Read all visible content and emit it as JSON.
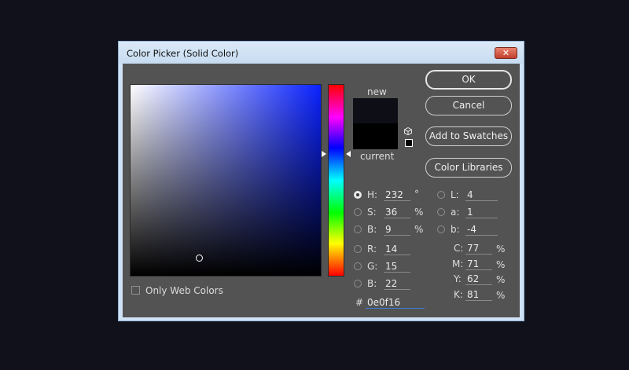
{
  "dialog": {
    "title": "Color Picker (Solid Color)",
    "close_glyph": "✕"
  },
  "preview": {
    "new_label": "new",
    "current_label": "current",
    "new_color": "#0e0f16",
    "current_color": "#000000"
  },
  "buttons": {
    "ok": "OK",
    "cancel": "Cancel",
    "add_to_swatches": "Add to Swatches",
    "color_libraries": "Color Libraries"
  },
  "only_web_colors": "Only Web Colors",
  "hsb": {
    "h": {
      "label": "H:",
      "value": "232",
      "unit": "°"
    },
    "s": {
      "label": "S:",
      "value": "36",
      "unit": "%"
    },
    "b": {
      "label": "B:",
      "value": "9",
      "unit": "%"
    }
  },
  "rgb": {
    "r": {
      "label": "R:",
      "value": "14"
    },
    "g": {
      "label": "G:",
      "value": "15"
    },
    "b": {
      "label": "B:",
      "value": "22"
    }
  },
  "lab": {
    "l": {
      "label": "L:",
      "value": "4"
    },
    "a": {
      "label": "a:",
      "value": "1"
    },
    "b": {
      "label": "b:",
      "value": "-4"
    }
  },
  "cmyk": {
    "c": {
      "label": "C:",
      "value": "77",
      "unit": "%"
    },
    "m": {
      "label": "M:",
      "value": "71",
      "unit": "%"
    },
    "y": {
      "label": "Y:",
      "value": "62",
      "unit": "%"
    },
    "k": {
      "label": "K:",
      "value": "81",
      "unit": "%"
    }
  },
  "hex": {
    "label": "#",
    "value": "0e0f16"
  },
  "selected_mode": "H",
  "icons": {
    "gamut_warning": "cube-icon",
    "web_safe": "websafe-swatch-icon"
  }
}
